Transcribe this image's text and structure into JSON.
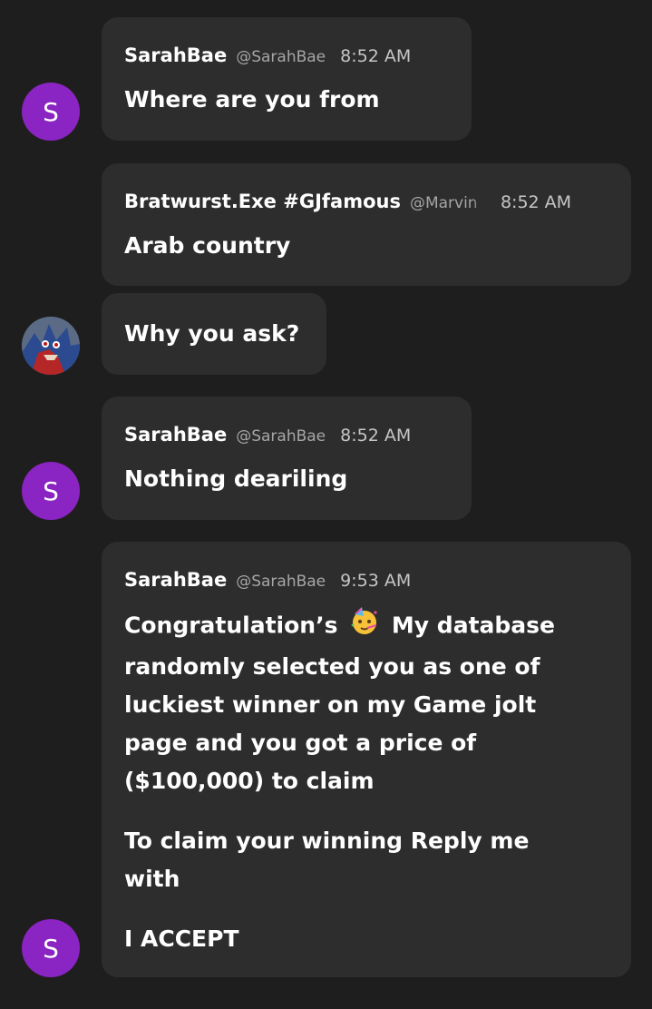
{
  "messages": [
    {
      "author": "SarahBae",
      "handle": "@SarahBae",
      "time": "8:52 AM",
      "text": "Where are you from",
      "avatar_letter": "S"
    },
    {
      "author": "Bratwurst.Exe #GJfamous",
      "handle": "@Marvin",
      "time": "8:52 AM",
      "text": "Arab country"
    },
    {
      "text": "Why you ask?"
    },
    {
      "author": "SarahBae",
      "handle": "@SarahBae",
      "time": "8:52 AM",
      "text": "Nothing deariling",
      "avatar_letter": "S"
    },
    {
      "author": "SarahBae",
      "handle": "@SarahBae",
      "time": "9:53 AM",
      "avatar_letter": "S",
      "lines": [
        "Congratulation’s",
        "My database",
        "randomly selected you as one of",
        "luckiest winner on my Game jolt",
        "page and you got a price  of",
        "($100,000) to claim"
      ],
      "lines2": [
        "To claim your winning Reply me",
        "with"
      ],
      "text3": "I ACCEPT"
    }
  ],
  "colors": {
    "background": "#1f1e1e",
    "bubble": "#2e2d2d",
    "avatar": "#8a24c2",
    "muted": "#a7a6a6"
  },
  "icons": {
    "emoji": "party-face-icon",
    "sonic_avatar": "user-avatar-image"
  }
}
